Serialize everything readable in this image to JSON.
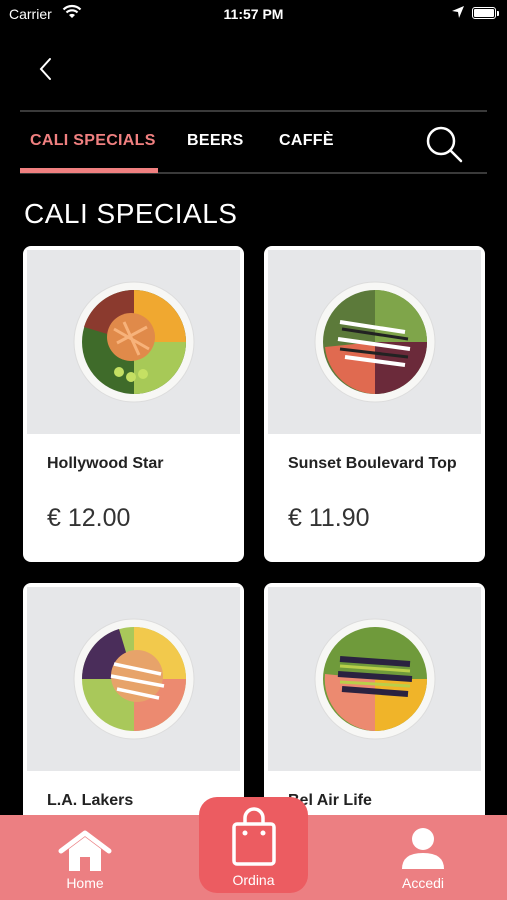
{
  "status_bar": {
    "carrier": "Carrier",
    "time": "11:57 PM"
  },
  "tabs": [
    {
      "label": "CALI SPECIALS",
      "active": true
    },
    {
      "label": "BEERS",
      "active": false
    },
    {
      "label": "CAFFÈ",
      "active": false
    }
  ],
  "section_title": "CALI SPECIALS",
  "products": [
    {
      "name": "Hollywood Star",
      "price": "€ 12.00"
    },
    {
      "name": "Sunset Boulevard Top",
      "price": "€ 11.90"
    },
    {
      "name": "L.A. Lakers",
      "price": ""
    },
    {
      "name": "Bel Air Life",
      "price": ""
    }
  ],
  "bottom_nav": {
    "home": "Home",
    "order": "Ordina",
    "login": "Accedi"
  },
  "colors": {
    "accent": "#f08080",
    "nav_bg": "#ec7f82",
    "order_bg": "#ec5c61",
    "background": "#000000"
  }
}
